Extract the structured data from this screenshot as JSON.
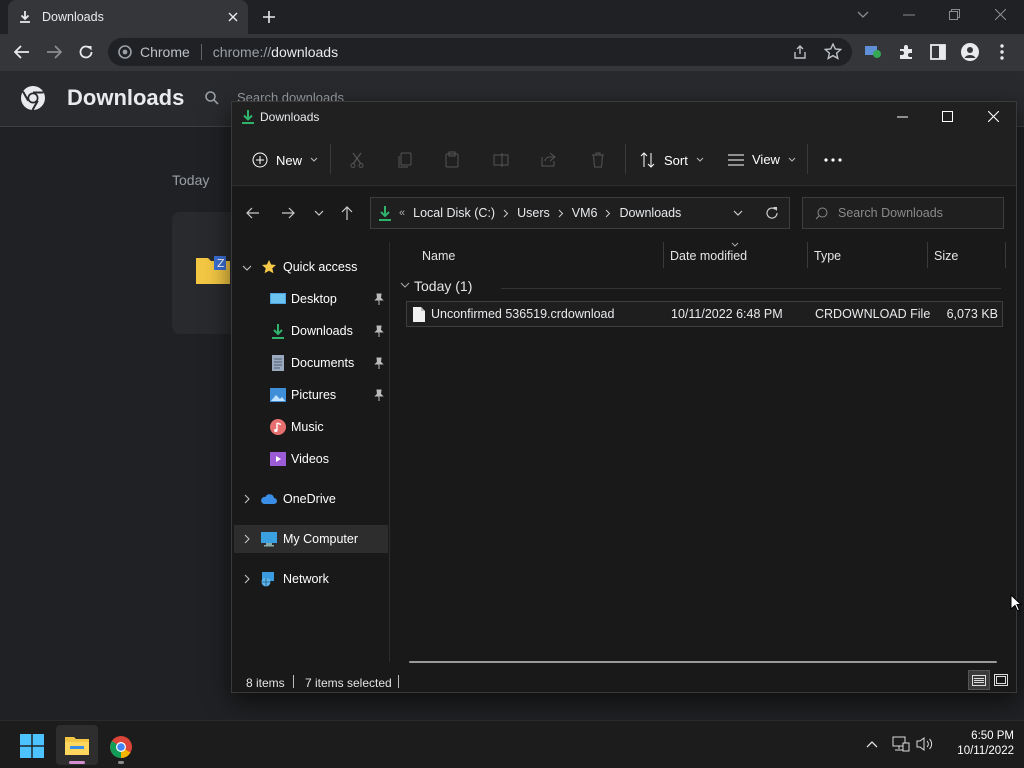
{
  "chrome": {
    "tab_title": "Downloads",
    "omnibox_label": "Chrome",
    "url_prefix": "chrome://",
    "url_path": "downloads",
    "page_title": "Downloads",
    "search_placeholder": "Search downloads",
    "section_today": "Today"
  },
  "explorer": {
    "title": "Downloads",
    "cmd": {
      "new": "New",
      "sort": "Sort",
      "view": "View"
    },
    "breadcrumb": [
      "Local Disk (C:)",
      "Users",
      "VM6",
      "Downloads"
    ],
    "search_placeholder": "Search Downloads",
    "nav": {
      "quick_access": "Quick access",
      "desktop": "Desktop",
      "downloads": "Downloads",
      "documents": "Documents",
      "pictures": "Pictures",
      "music": "Music",
      "videos": "Videos",
      "onedrive": "OneDrive",
      "my_computer": "My Computer",
      "network": "Network"
    },
    "columns": {
      "name": "Name",
      "date": "Date modified",
      "type": "Type",
      "size": "Size"
    },
    "group_header": "Today (1)",
    "file": {
      "name": "Unconfirmed 536519.crdownload",
      "date": "10/11/2022 6:48 PM",
      "type": "CRDOWNLOAD File",
      "size": "6,073 KB"
    },
    "status": {
      "items": "8 items",
      "selected": "7 items selected"
    }
  },
  "taskbar": {
    "time": "6:50 PM",
    "date": "10/11/2022"
  },
  "colors": {
    "accent_green": "#2fb36a",
    "selection": "#2d2d2d",
    "folder_yellow": "#f3c744"
  }
}
